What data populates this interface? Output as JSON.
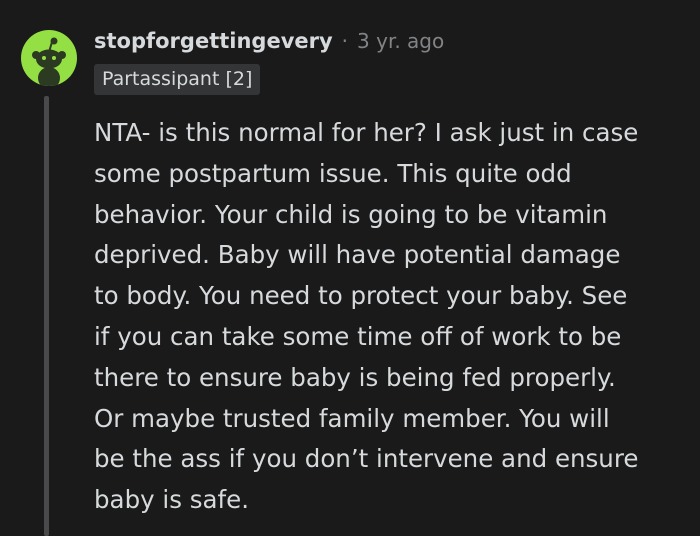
{
  "comment": {
    "username": "stopforgettingevery",
    "separator": "·",
    "timestamp": "3 yr. ago",
    "flair": "Partassipant [2]",
    "avatar_icon": "snoo-avatar-icon",
    "avatar_color": "#94e044",
    "body_lines": [
      "NTA- is this normal for her? I ask just in case",
      "some postpartum issue. This quite odd",
      "behavior. Your child is going to be vitamin",
      "deprived. Baby will have potential damage",
      "to body. You need to protect your baby. See",
      "if you can take some time off of work to be",
      "there to ensure baby is being fed properly.",
      "Or maybe trusted family member. You will",
      "be the ass if you don’t intervene and ensure",
      "baby is safe."
    ]
  }
}
